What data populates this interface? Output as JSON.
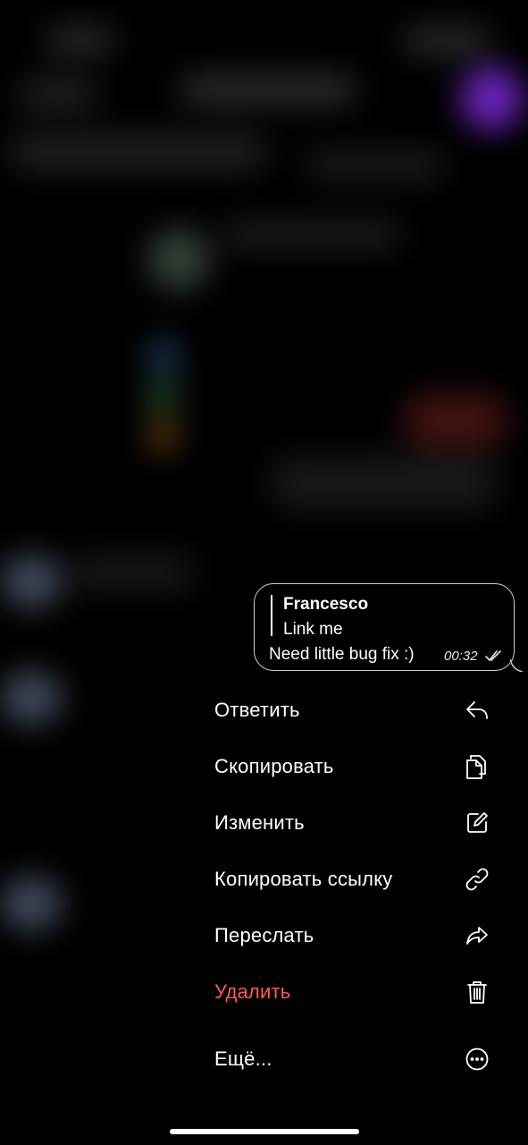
{
  "message": {
    "reply_author": "Francesco",
    "reply_text": "Link me",
    "text": "Need little bug fix :)",
    "time": "00:32",
    "status_icon": "double-check-icon"
  },
  "menu": {
    "items": [
      {
        "label": "Ответить",
        "icon": "reply-icon"
      },
      {
        "label": "Скопировать",
        "icon": "copy-icon"
      },
      {
        "label": "Изменить",
        "icon": "edit-icon"
      },
      {
        "label": "Копировать ссылку",
        "icon": "link-icon"
      },
      {
        "label": "Переслать",
        "icon": "forward-icon"
      },
      {
        "label": "Удалить",
        "icon": "trash-icon",
        "color": "#ff5a4f"
      },
      {
        "label": "Ещё...",
        "icon": "more-icon"
      }
    ]
  },
  "colors": {
    "background": "#000000",
    "danger": "#ff5a4f",
    "bubble_border": "#cfcfcf"
  }
}
